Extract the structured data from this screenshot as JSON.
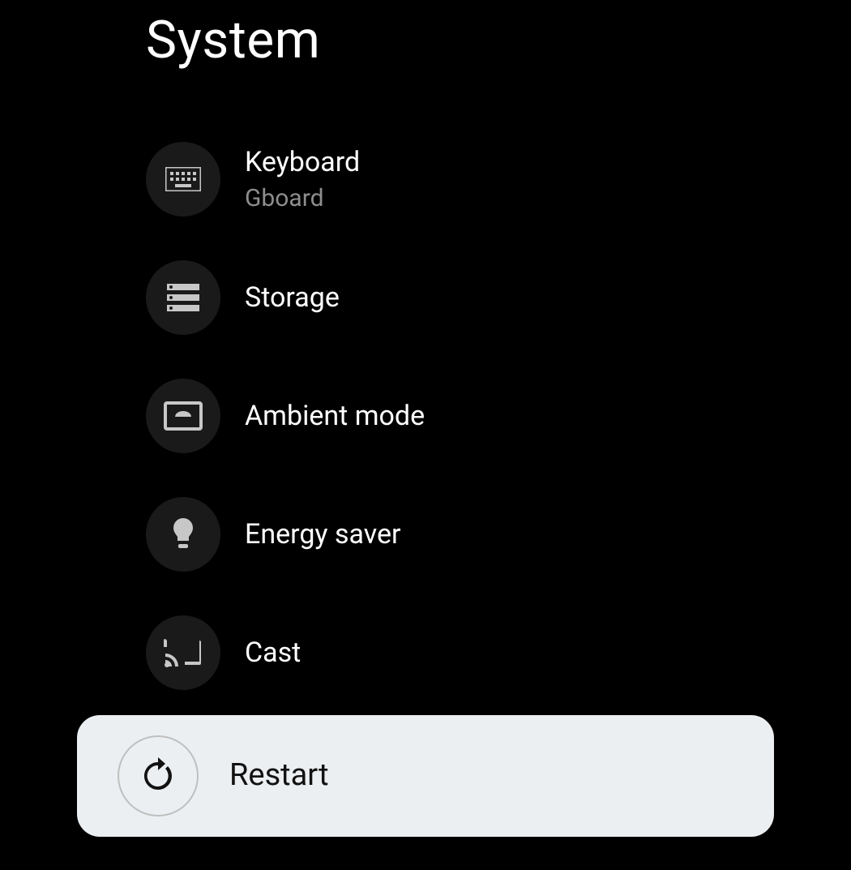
{
  "page": {
    "title": "System"
  },
  "items": [
    {
      "icon": "keyboard",
      "label": "Keyboard",
      "sublabel": "Gboard"
    },
    {
      "icon": "storage",
      "label": "Storage",
      "sublabel": ""
    },
    {
      "icon": "ambient-mode",
      "label": "Ambient mode",
      "sublabel": ""
    },
    {
      "icon": "energy-saver",
      "label": "Energy saver",
      "sublabel": ""
    },
    {
      "icon": "cast",
      "label": "Cast",
      "sublabel": ""
    },
    {
      "icon": "restart",
      "label": "Restart",
      "sublabel": ""
    }
  ],
  "selected_index": 5
}
